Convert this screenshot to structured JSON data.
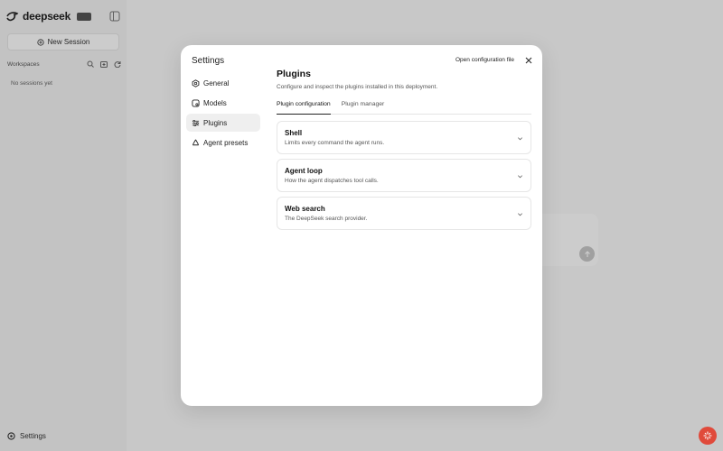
{
  "background": {
    "brand": "deepseek",
    "brand_badge": "",
    "new_session_label": "New Session",
    "workspaces_title": "Workspaces",
    "no_sessions_text": "No sessions yet",
    "bottom_settings_label": "Settings"
  },
  "modal": {
    "title": "Settings",
    "nav": [
      {
        "label": "General",
        "icon": "hexagon-icon"
      },
      {
        "label": "Models",
        "icon": "models-icon"
      },
      {
        "label": "Plugins",
        "icon": "sliders-icon"
      },
      {
        "label": "Agent presets",
        "icon": "recycle-icon"
      }
    ],
    "active_nav": "Plugins",
    "open_config_label": "Open configuration file",
    "close_icon": "close-icon",
    "content": {
      "title": "Plugins",
      "description": "Configure and inspect the plugins installed in this deployment.",
      "tabs": [
        "Plugin configuration",
        "Plugin manager"
      ],
      "active_tab": "Plugin configuration",
      "plugins": [
        {
          "name": "Shell",
          "description": "Limits every command the agent runs."
        },
        {
          "name": "Agent loop",
          "description": "How the agent dispatches tool calls."
        },
        {
          "name": "Web search",
          "description": "The DeepSeek search provider."
        }
      ]
    }
  },
  "colors": {
    "fab": "#e04a3b",
    "active_nav_bg": "#efefef"
  }
}
